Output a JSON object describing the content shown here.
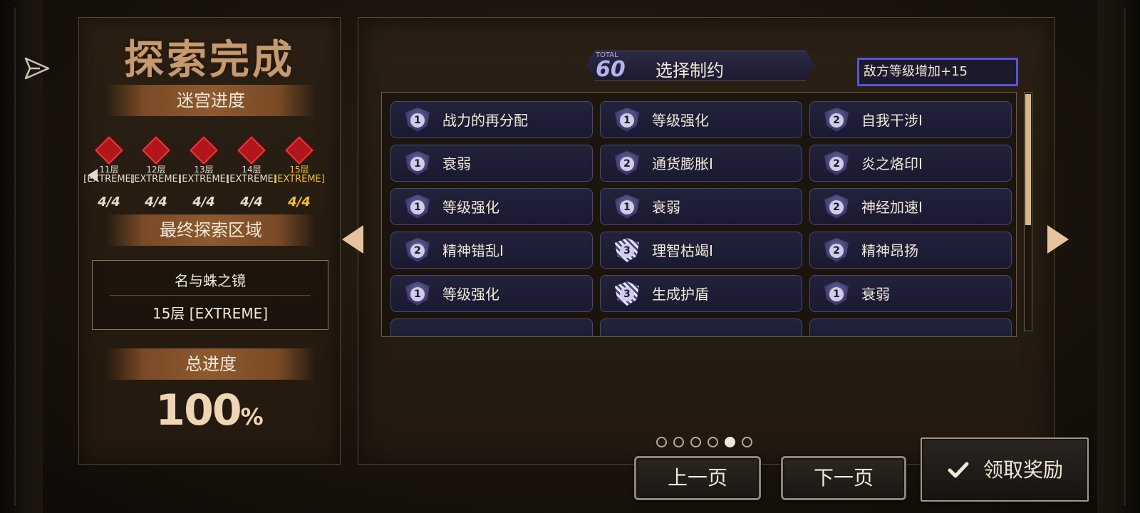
{
  "left": {
    "title": "探索完成",
    "maze_progress_label": "迷宫进度",
    "floors": [
      {
        "label": "11层",
        "difficulty": "[EXTREME]",
        "progress": "4/4",
        "current": false
      },
      {
        "label": "12层",
        "difficulty": "[EXTREME]",
        "progress": "4/4",
        "current": false
      },
      {
        "label": "13层",
        "difficulty": "[EXTREME]",
        "progress": "4/4",
        "current": false
      },
      {
        "label": "14层",
        "difficulty": "[EXTREME]",
        "progress": "4/4",
        "current": false
      },
      {
        "label": "15层",
        "difficulty": "[EXTREME]",
        "progress": "4/4",
        "current": true
      }
    ],
    "final_area_label": "最终探索区域",
    "final_area_name": "名与蛛之镜",
    "final_area_floor": "15层 [EXTREME]",
    "total_progress_label": "总进度",
    "total_progress_value": "100",
    "total_progress_unit": "%"
  },
  "right": {
    "total_label": "TOTAL",
    "total_value": "60",
    "title": "选择制约",
    "effect_text": "敌方等级增加+15",
    "constraints": [
      {
        "level": "1",
        "label": "战力的再分配"
      },
      {
        "level": "1",
        "label": "等级强化"
      },
      {
        "level": "2",
        "label": "自我干涉Ⅰ"
      },
      {
        "level": "1",
        "label": "衰弱"
      },
      {
        "level": "2",
        "label": "通货膨胀Ⅰ"
      },
      {
        "level": "2",
        "label": "炎之烙印Ⅰ"
      },
      {
        "level": "1",
        "label": "等级强化"
      },
      {
        "level": "1",
        "label": "衰弱"
      },
      {
        "level": "2",
        "label": "神经加速Ⅰ"
      },
      {
        "level": "2",
        "label": "精神错乱Ⅰ"
      },
      {
        "level": "3",
        "label": "理智枯竭Ⅰ"
      },
      {
        "level": "2",
        "label": "精神昂扬"
      },
      {
        "level": "1",
        "label": "等级强化"
      },
      {
        "level": "3",
        "label": "生成护盾"
      },
      {
        "level": "1",
        "label": "衰弱"
      }
    ],
    "pages": {
      "count": 6,
      "current": 5
    }
  },
  "buttons": {
    "prev_page": "上一页",
    "next_page": "下一页",
    "claim": "领取奖励"
  },
  "icons": {
    "share": "share-icon",
    "check": "check-icon",
    "nav_prev": "triangle-left-icon",
    "nav_next": "triangle-right-icon"
  }
}
